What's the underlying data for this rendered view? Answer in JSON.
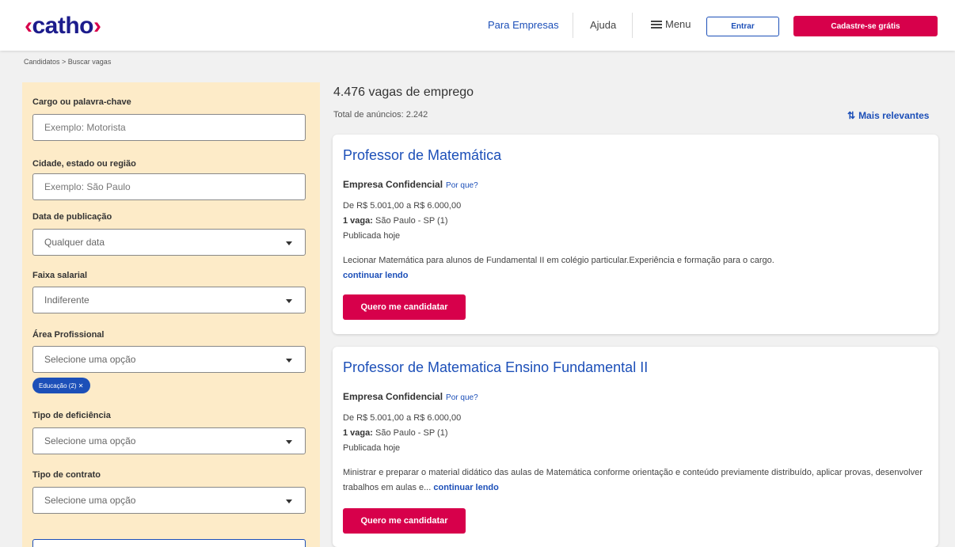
{
  "header": {
    "logo_prefix": "‹",
    "logo_text": "catho",
    "logo_suffix": "›",
    "nav": {
      "empresas": "Para Empresas",
      "ajuda": "Ajuda",
      "menu": "Menu"
    },
    "login_label": "Entrar",
    "signup_label": "Cadastre-se grátis"
  },
  "breadcrumb": "Candidatos > Buscar vagas",
  "filters": {
    "keyword_label": "Cargo ou palavra-chave",
    "keyword_placeholder": "Exemplo: Motorista",
    "city_label": "Cidade, estado ou região",
    "city_placeholder": "Exemplo: São Paulo",
    "date_label": "Data de publicação",
    "date_value": "Qualquer data",
    "salary_label": "Faixa salarial",
    "salary_value": "Indiferente",
    "area_label": "Área Profissional",
    "area_value": "Selecione uma opção",
    "area_chip": "Educação (2) ✕",
    "disability_label": "Tipo de deficiência",
    "disability_value": "Selecione uma opção",
    "contract_label": "Tipo de contrato",
    "contract_value": "Selecione uma opção"
  },
  "results": {
    "title": "4.476 vagas de emprego",
    "total": "Total de anúncios: 2.242",
    "sort_label": "Mais relevantes",
    "sort_icon": "sort-arrows-icon",
    "jobs": [
      {
        "title": "Professor de Matemática",
        "company": "Empresa Confidencial",
        "why": "Por que?",
        "salary": "De R$ 5.001,00 a R$ 6.000,00",
        "vacancy_label": "1 vaga:",
        "location": "São Paulo - SP (1)",
        "published": "Publicada hoje",
        "description": "Lecionar Matemática para alunos de Fundamental II em colégio particular.Experiência e formação para o cargo.",
        "more": "continuar lendo",
        "apply": "Quero me candidatar"
      },
      {
        "title": "Professor de Matematica Ensino Fundamental II",
        "company": "Empresa Confidencial",
        "why": "Por que?",
        "salary": "De R$ 5.001,00 a R$ 6.000,00",
        "vacancy_label": "1 vaga:",
        "location": "São Paulo - SP (1)",
        "published": "Publicada hoje",
        "description": "Ministrar e preparar o material didático das aulas de Matemática conforme orientação e conteúdo previamente distribuído, aplicar provas, desenvolver trabalhos em aulas e...",
        "more": "continuar lendo",
        "apply": "Quero me candidatar"
      }
    ]
  },
  "colors": {
    "brand_pink": "#d7004b",
    "brand_blue": "#1c4fb8",
    "sidebar_bg": "#fdebc8"
  }
}
